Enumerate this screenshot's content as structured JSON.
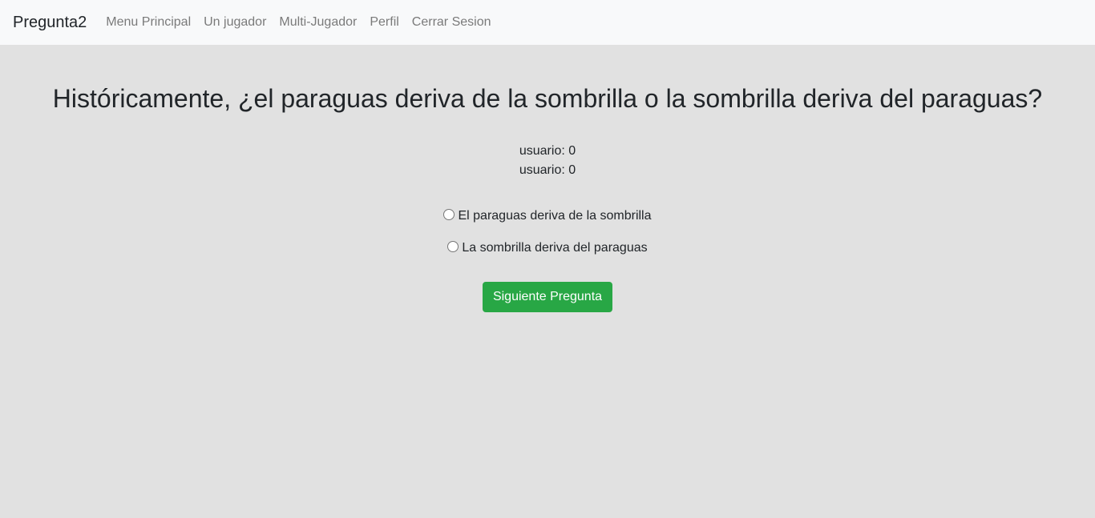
{
  "navbar": {
    "brand": "Pregunta2",
    "links": [
      "Menu Principal",
      "Un jugador",
      "Multi-Jugador",
      "Perfil",
      "Cerrar Sesion"
    ]
  },
  "question": {
    "text": "Históricamente, ¿el paraguas deriva de la sombrilla o la sombrilla deriva del paraguas?"
  },
  "scores": [
    "usuario: 0",
    "usuario: 0"
  ],
  "options": [
    {
      "label": "El paraguas deriva de la sombrilla",
      "selected": false
    },
    {
      "label": "La sombrilla deriva del paraguas",
      "selected": false
    }
  ],
  "actions": {
    "next_label": "Siguiente Pregunta"
  },
  "colors": {
    "navbar_bg": "#f8f9fa",
    "page_bg": "#e1e1e1",
    "button_green": "#28a745"
  }
}
